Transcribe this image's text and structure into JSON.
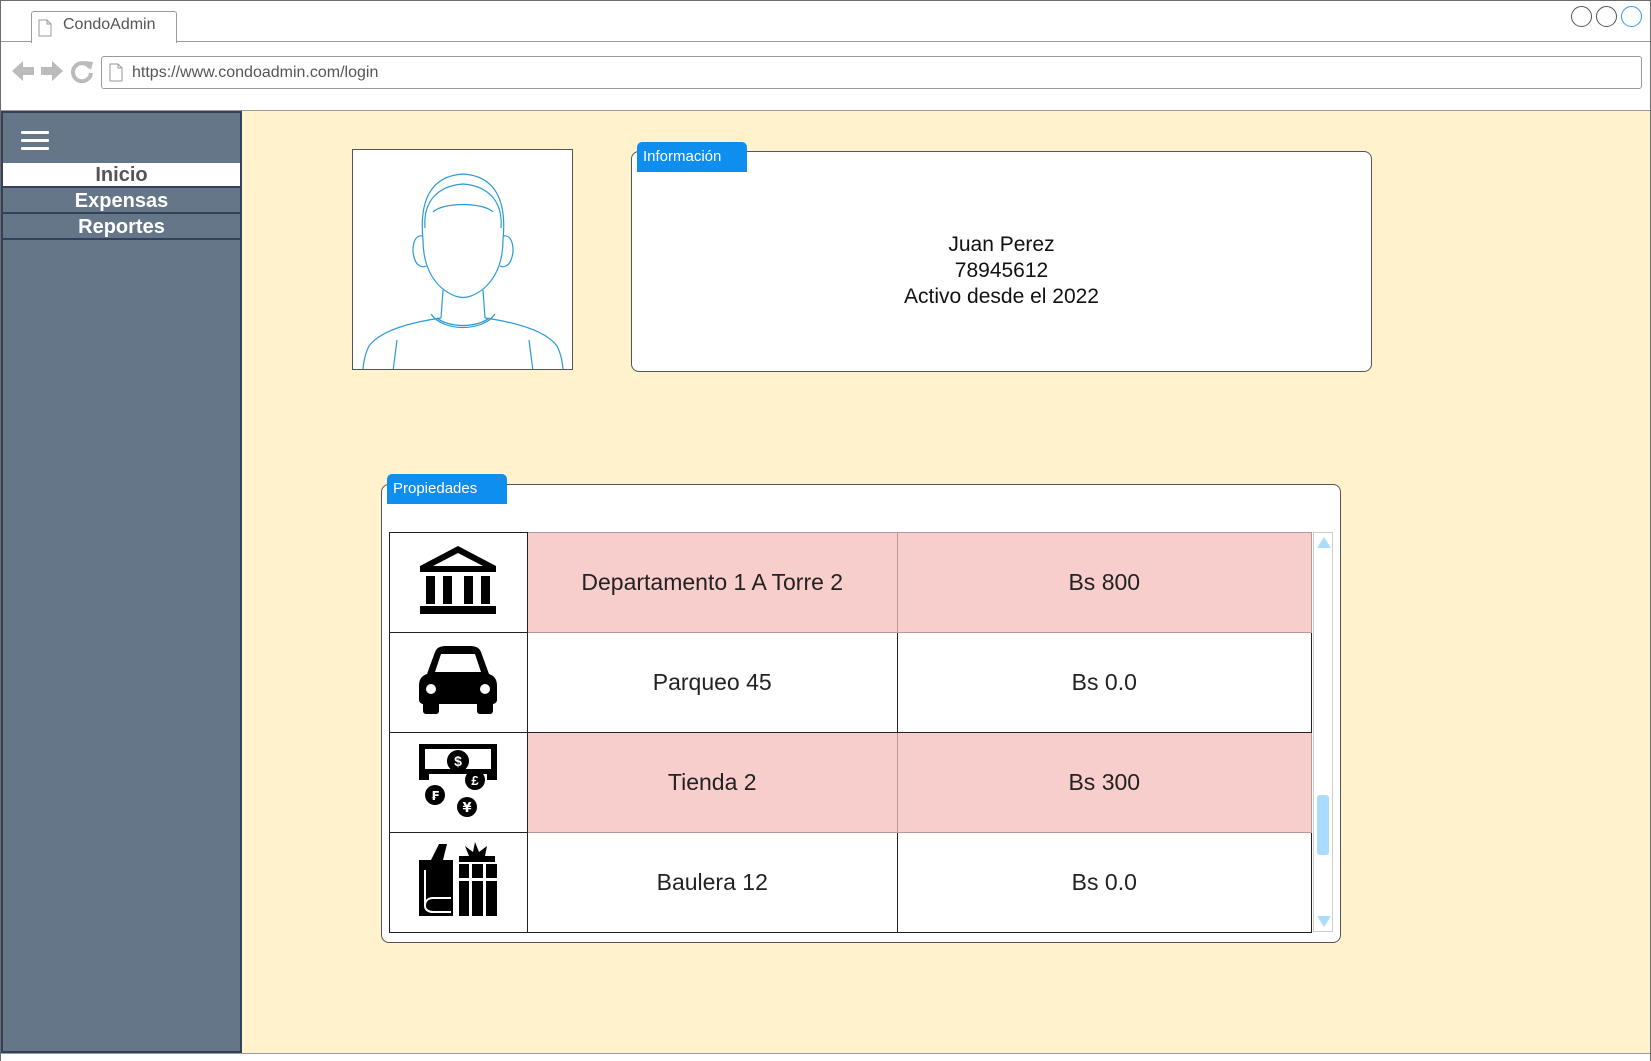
{
  "browser": {
    "tab_title": "CondoAdmin",
    "url": "https://www.condoadmin.com/login"
  },
  "sidebar": {
    "items": [
      {
        "label": "Inicio",
        "active": true
      },
      {
        "label": "Expensas",
        "active": false
      },
      {
        "label": "Reportes",
        "active": false
      }
    ]
  },
  "info": {
    "tab_label": "Información",
    "name": "Juan Perez",
    "phone": "78945612",
    "since": "Activo desde el 2022"
  },
  "properties": {
    "tab_label": "Propiedades",
    "rows": [
      {
        "icon": "bank-icon",
        "name": "Departamento 1 A Torre 2",
        "amount": "Bs 800",
        "highlight": true
      },
      {
        "icon": "car-icon",
        "name": "Parqueo 45",
        "amount": "Bs 0.0",
        "highlight": false
      },
      {
        "icon": "currency-exchange-icon",
        "name": "Tienda 2",
        "amount": "Bs 300",
        "highlight": true
      },
      {
        "icon": "storage-boxes-icon",
        "name": "Baulera 12",
        "amount": "Bs 0.0",
        "highlight": false
      }
    ]
  },
  "colors": {
    "content_bg": "#fff2cc",
    "sidebar_bg": "#647687",
    "tab_accent": "#0e8ff0",
    "row_highlight": "#f8cecc"
  }
}
